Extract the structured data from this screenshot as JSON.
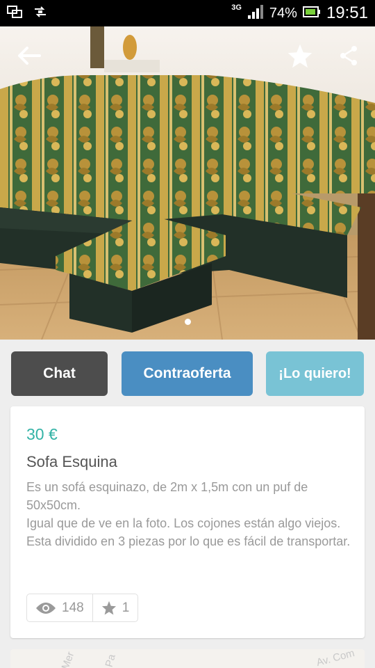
{
  "status_bar": {
    "network": "3G",
    "battery": "74%",
    "time": "19:51"
  },
  "header": {
    "icons": [
      "back-arrow-icon",
      "star-icon",
      "share-icon"
    ]
  },
  "photo": {
    "page_count": 1,
    "current_page": 1
  },
  "actions": {
    "chat_label": "Chat",
    "counter_offer_label": "Contraoferta",
    "want_label": "¡Lo quiero!"
  },
  "listing": {
    "price": "30 €",
    "title": "Sofa Esquina",
    "description_line1": "Es un sofá esquinazo, de 2m x 1,5m con un puf de 50x50cm.",
    "description_line2": "Igual que de ve en la foto. Los cojones están algo viejos. Esta dividido en 3 piezas por lo que es fácil de transportar.",
    "views": "148",
    "favorites": "1"
  },
  "map": {
    "label_1": "Mer",
    "label_2": "Pa",
    "label_3": "Av. Com"
  },
  "colors": {
    "chat_button": "#4d4d4d",
    "counter_offer_button": "#4a8ec2",
    "want_button": "#79c3d5",
    "price": "#33b3a6"
  }
}
